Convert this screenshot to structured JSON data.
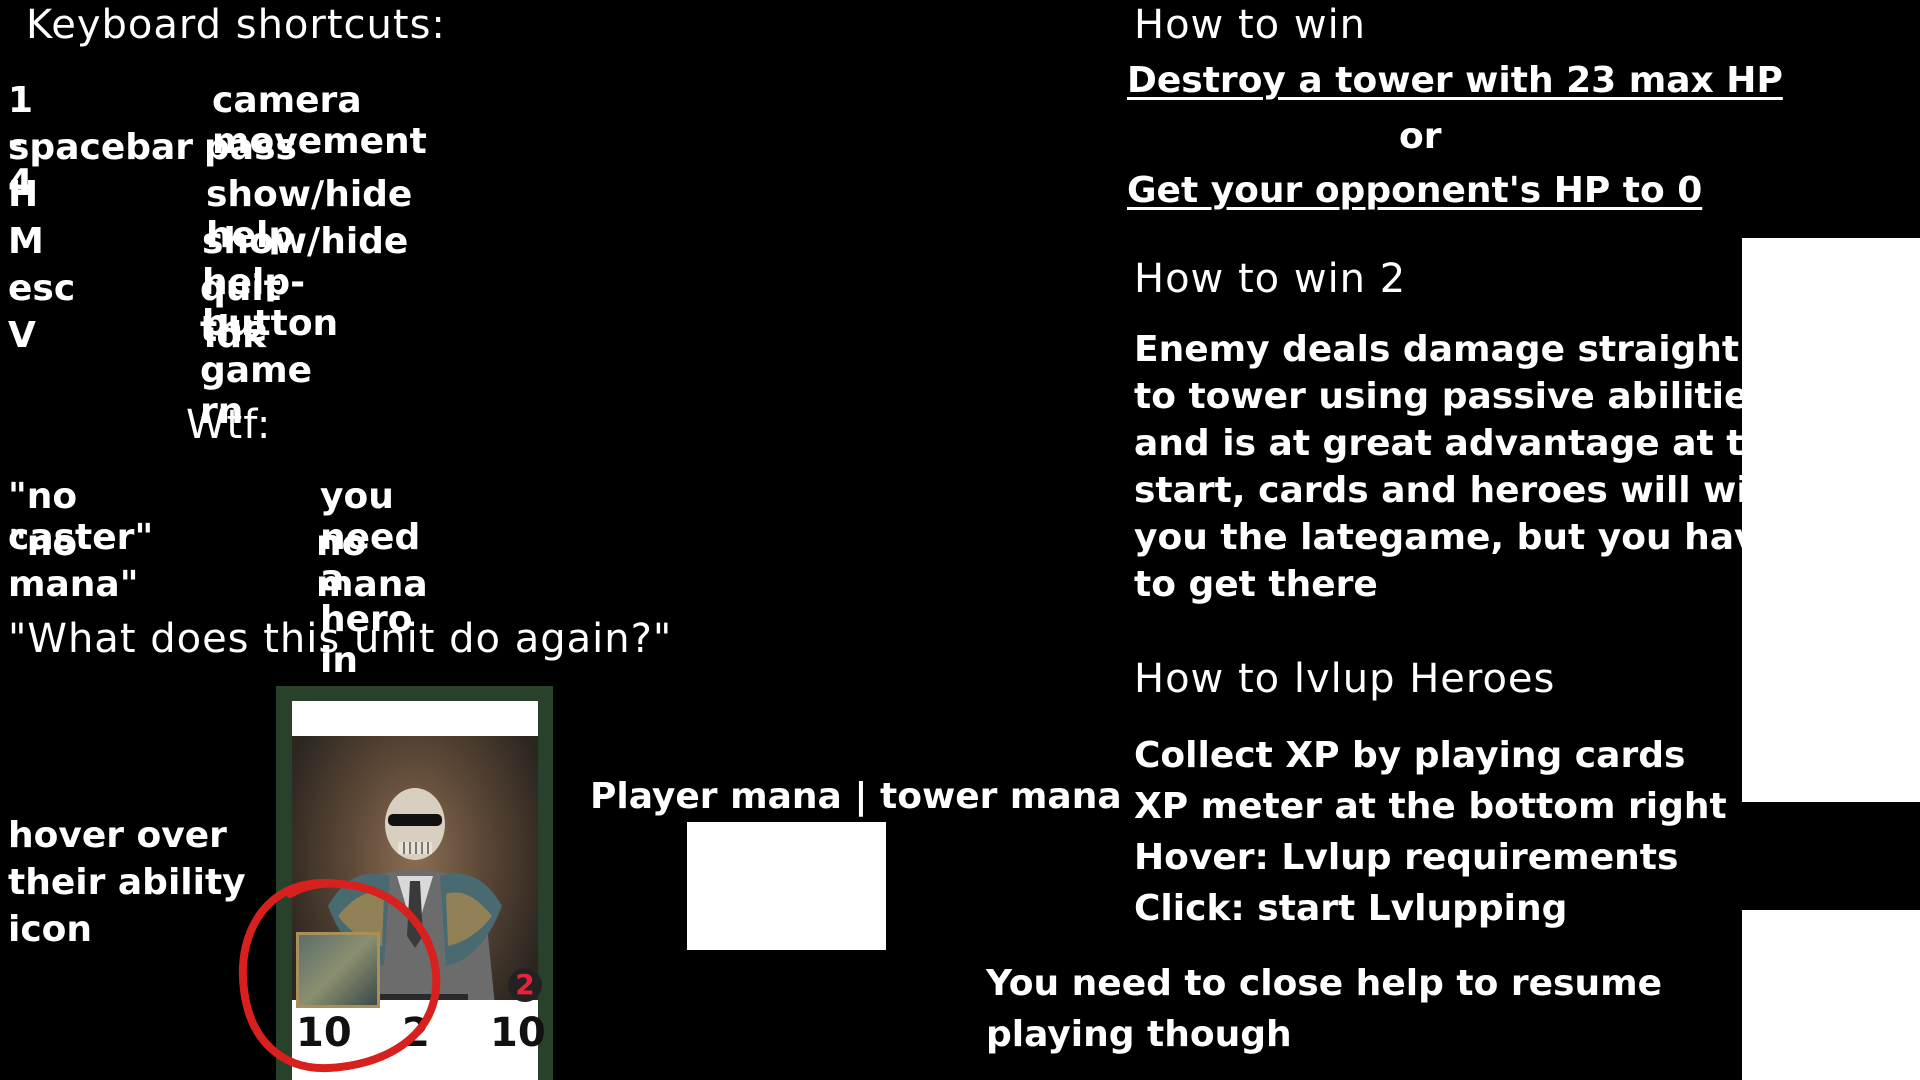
{
  "shortcuts": {
    "title": "Keyboard shortcuts:",
    "items": [
      {
        "key": "1 - 4",
        "desc": "camera movement"
      },
      {
        "key": "spacebar",
        "desc": "pass"
      },
      {
        "key": "H",
        "desc": "show/hide help"
      },
      {
        "key": "M",
        "desc": "show/hide help-button"
      },
      {
        "key": "esc",
        "desc": "quit the game rn"
      },
      {
        "key": "V",
        "desc": "idk"
      }
    ]
  },
  "wtf": {
    "title": "Wtf:",
    "items": [
      {
        "key": "\"no caster\"",
        "desc": "you need a hero in the lane to play a card"
      },
      {
        "key": "\"no mana\"",
        "desc": "no mana"
      }
    ]
  },
  "unit_help": {
    "title": "\"What does this unit do again?\"",
    "hover_lines": [
      "hover over",
      "their ability",
      "icon"
    ],
    "card": {
      "left_stat": "10",
      "mid_stat": "2",
      "right_stat": "10",
      "badge": "2"
    },
    "mana_label": "Player mana | tower mana"
  },
  "how_to_win": {
    "title": "How to win",
    "option1": "Destroy a tower with 23 max HP",
    "or": "or",
    "option2": "Get your opponent's HP to 0"
  },
  "how_to_win_2": {
    "title": "How to win 2",
    "lines": [
      "Enemy deals damage straight",
      "to tower using passive abilities",
      "and is at great advantage at the",
      "start, cards and heroes will win",
      "you the lategame, but you have",
      "to get there"
    ]
  },
  "lvlup": {
    "title": "How to lvlup Heroes",
    "lines": [
      "Collect XP by playing cards",
      "XP meter at the bottom right",
      "Hover:  Lvlup requirements",
      "Click: start Lvlupping"
    ]
  },
  "footer": {
    "lines": [
      "You need to close help to resume",
      "playing though"
    ]
  },
  "colors": {
    "background": "#000000",
    "text": "#ffffff",
    "circle": "#d8201e",
    "badge": "#e8223a"
  }
}
